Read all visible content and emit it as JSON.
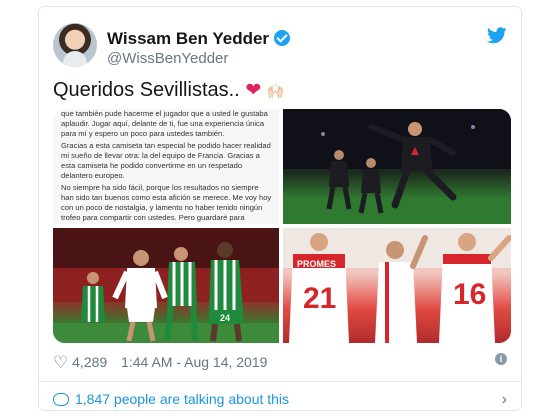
{
  "tweet": {
    "name": "Wissam Ben Yedder",
    "handle": "@WissBenYedder",
    "text": "Queridos Sevillistas..",
    "heart_emoji": "❤",
    "clap_emoji": "🙌🏻",
    "likes": "4,289",
    "timestamp": "1:44 AM - Aug 14, 2019",
    "talking": "1,847 people are talking about this"
  },
  "letter": {
    "lines": [
      "que también pude hacerme el jugador que a usted le gustaba aplaudir. Jugar aquí, delante de ti, fue una experiencia única para mí y espero un poco para ustedes también.",
      "Gracias a esta camiseta tan especial he podido hacer realidad mi sueño de llevar otra: la del equipo de Francia. Gracias a esta camiseta he podido convertirme en un respetado delantero europeo.",
      "No siempre ha sido fácil, porque los resultados no siempre han sido tan buenos como esta afición se merece. Me voy hoy con un poco de nostalgia, y lamento no haber tenido ningún trofeo para compartir con ustedes. Pero guardaré para siempre los recuerdos de esas veladas únicas que pasé"
    ]
  },
  "jerseys": {
    "left_number": "21",
    "left_name": "PROMES",
    "right_number": "16",
    "green_number": "24"
  },
  "colors": {
    "accent": "#1da1f2",
    "heart": "#e0245e",
    "sevilla_red": "#d7262b",
    "betis_green": "#1f8a3c"
  },
  "icons": {
    "verified": "verified-badge-icon",
    "bird": "twitter-bird-icon",
    "heart": "heart-outline-icon",
    "info": "info-icon",
    "comment": "comment-bubble-icon",
    "chevron": "chevron-right-icon"
  }
}
